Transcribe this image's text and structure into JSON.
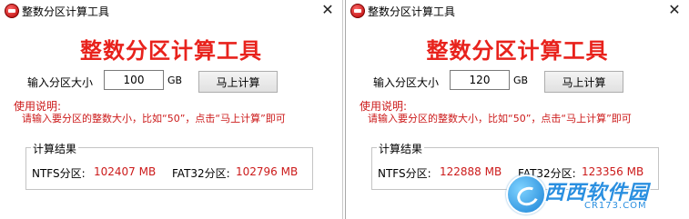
{
  "windows": [
    {
      "title": "整数分区计算工具",
      "heading": "整数分区计算工具",
      "size_label": "输入分区大小",
      "size_value": "100",
      "unit": "GB",
      "button_label": "马上计算",
      "help_title": "使用说明:",
      "help_text": "请输入要分区的整数大小，比如“50”，点击“马上计算”即可",
      "result_title": "计算结果",
      "ntfs_label": "NTFS分区:",
      "ntfs_value": "102407 MB",
      "fat32_label": "FAT32分区:",
      "fat32_value": "102796 MB",
      "close_glyph": "✕"
    },
    {
      "title": "整数分区计算工具",
      "heading": "整数分区计算工具",
      "size_label": "输入分区大小",
      "size_value": "120",
      "unit": "GB",
      "button_label": "马上计算",
      "help_title": "使用说明:",
      "help_text": "请输入要分区的整数大小，比如“50”，点击“马上计算”即可",
      "result_title": "计算结果",
      "ntfs_label": "NTFS分区:",
      "ntfs_value": "122888 MB",
      "fat32_label": "FAT32分区:",
      "fat32_value": "123356 MB",
      "close_glyph": "✕"
    }
  ],
  "watermark": {
    "text": "西西软件园",
    "sub": "CR173.COM"
  },
  "colors": {
    "accent_red": "#e8221c",
    "text_red": "#cc1a1a",
    "watermark_blue": "#2a8fe0"
  },
  "icons": {
    "app": "app-icon",
    "close": "close-icon"
  }
}
